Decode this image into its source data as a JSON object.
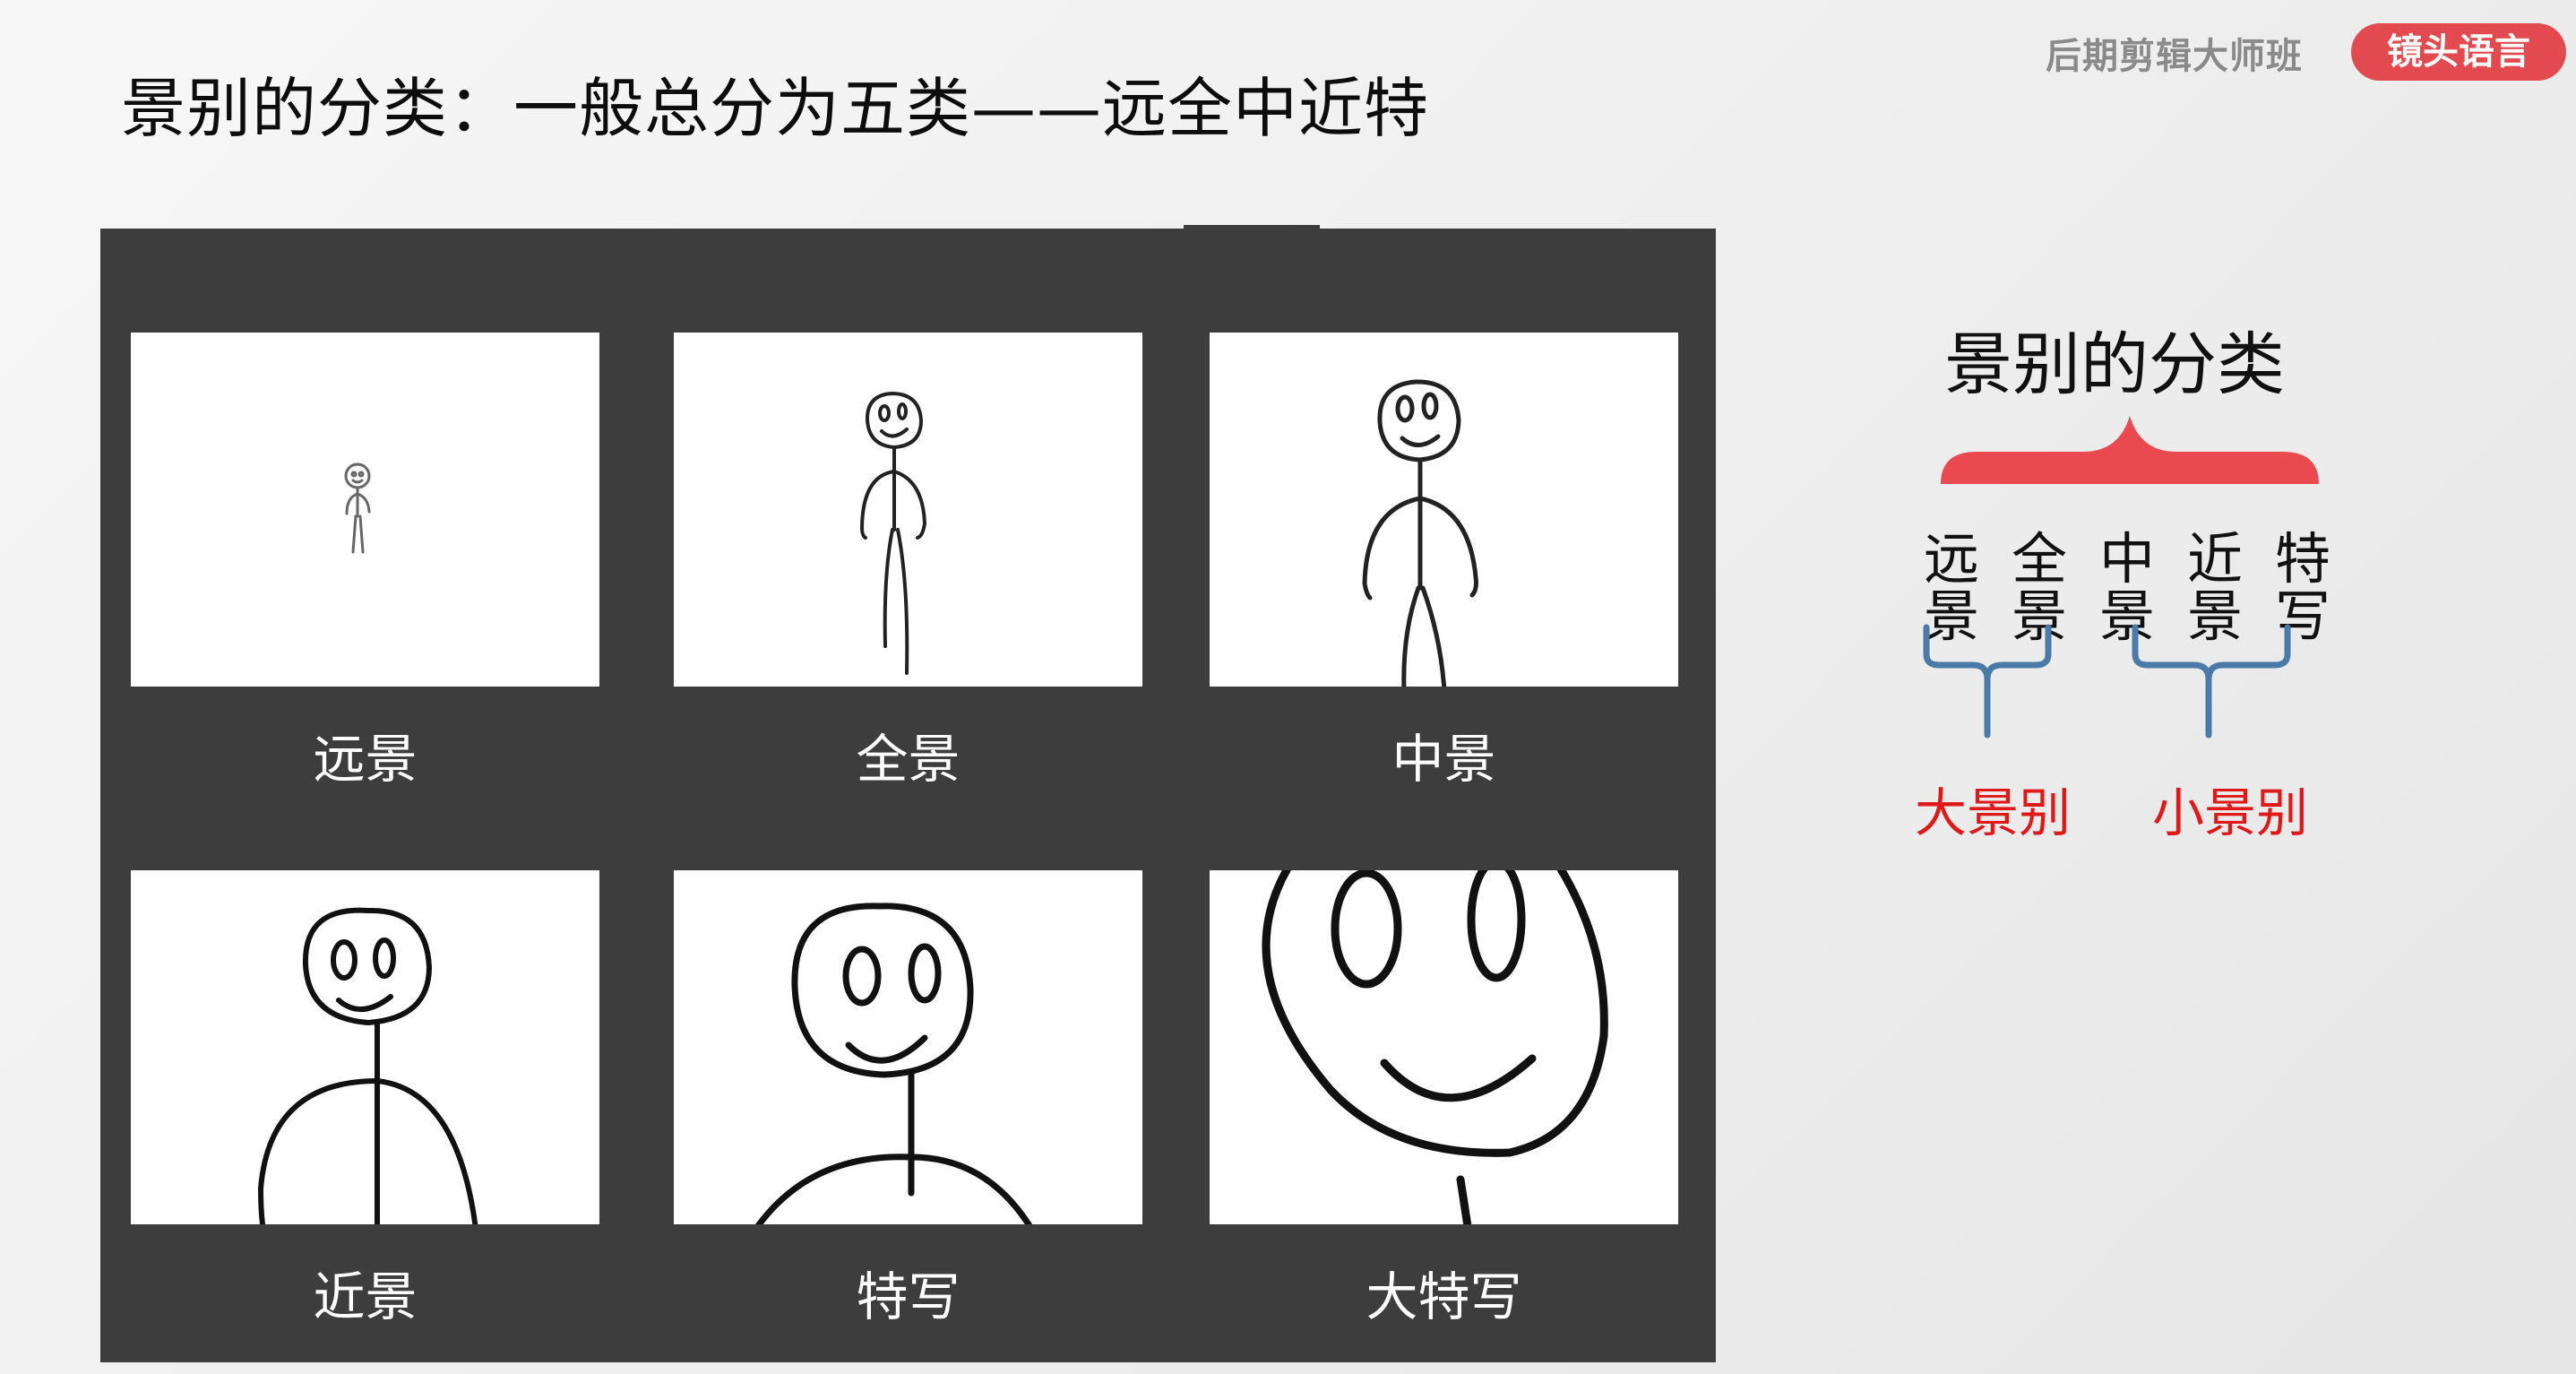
{
  "header": {
    "title": "景别的分类：一般总分为五类——远全中近特",
    "brand": "后期剪辑大师班",
    "tag": "镜头语言"
  },
  "panel": {
    "cells": [
      {
        "label": "远景",
        "shot": "extreme-long-shot"
      },
      {
        "label": "全景",
        "shot": "full-shot"
      },
      {
        "label": "中景",
        "shot": "medium-shot"
      },
      {
        "label": "近景",
        "shot": "close-shot"
      },
      {
        "label": "特写",
        "shot": "close-up"
      },
      {
        "label": "大特写",
        "shot": "extreme-close-up"
      }
    ]
  },
  "classification": {
    "title": "景别的分类",
    "types": [
      {
        "line1": "远",
        "line2": "景"
      },
      {
        "line1": "全",
        "line2": "景"
      },
      {
        "line1": "中",
        "line2": "景"
      },
      {
        "line1": "近",
        "line2": "景"
      },
      {
        "line1": "特",
        "line2": "写"
      }
    ],
    "groups": [
      {
        "label": "大景别"
      },
      {
        "label": "小景别"
      }
    ],
    "colors": {
      "top_brace": "#e84a4f",
      "group_brace": "#4a7aa8",
      "group_label": "#e01818"
    }
  }
}
